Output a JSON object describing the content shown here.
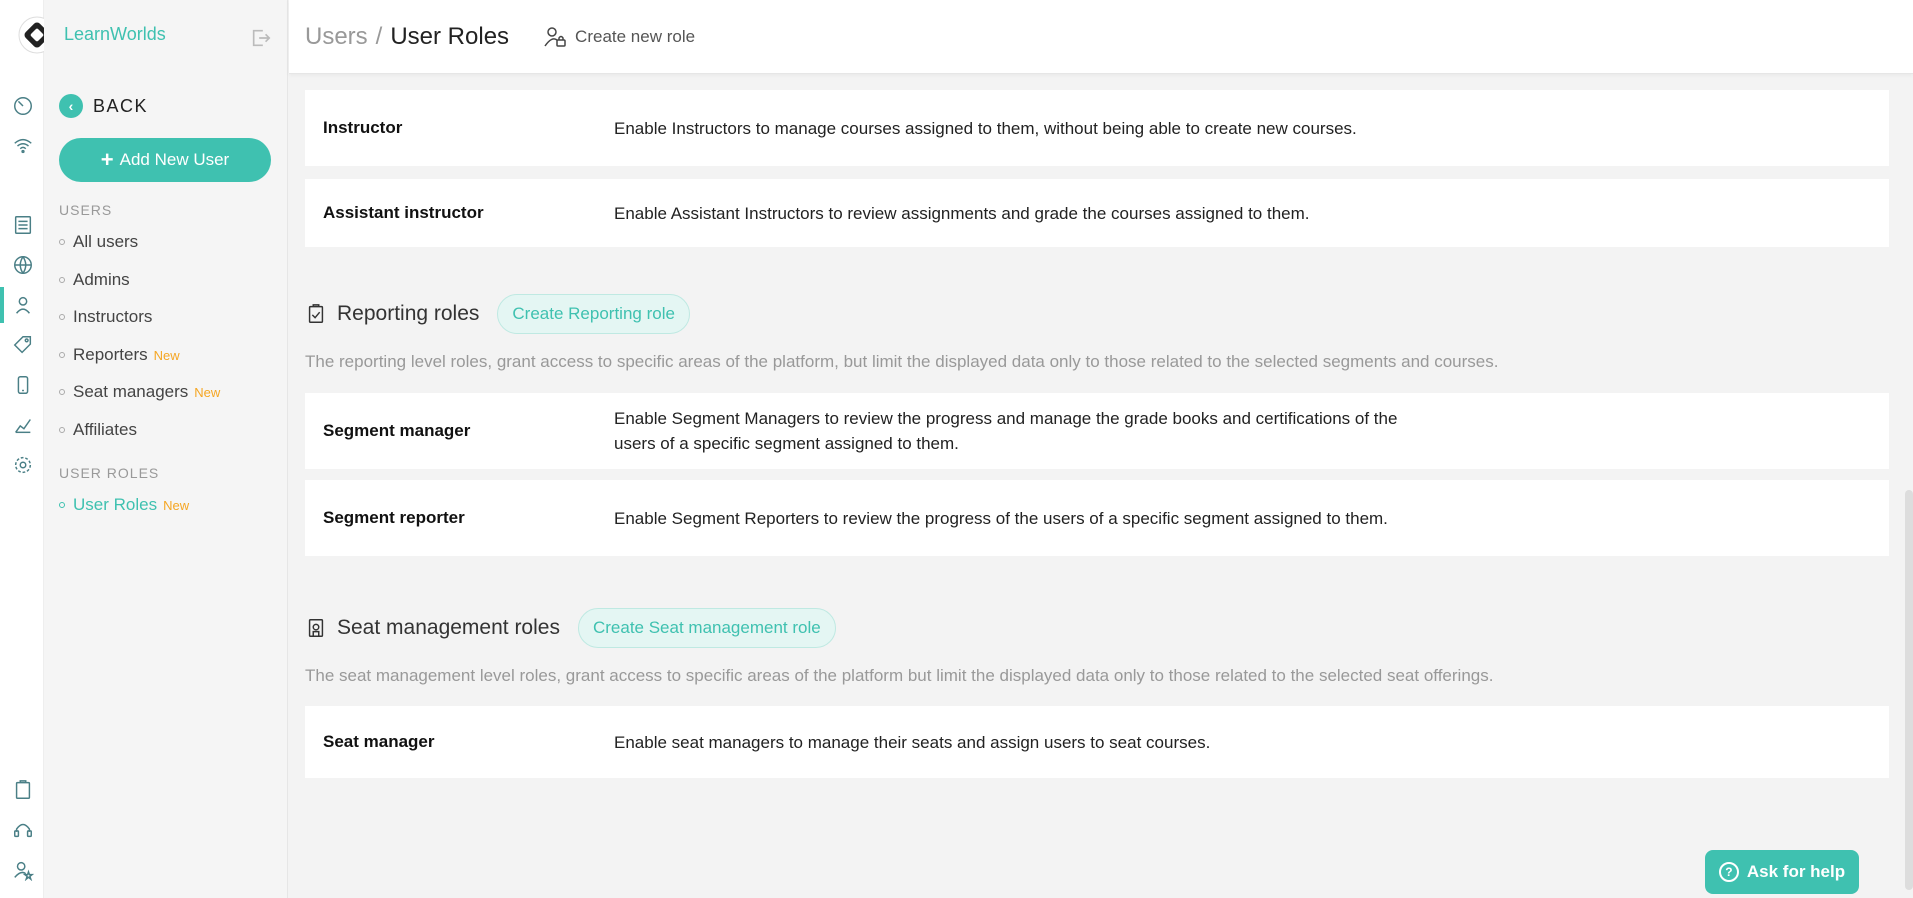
{
  "brand": {
    "name": "LearnWorlds"
  },
  "sidebar": {
    "back_label": "BACK",
    "add_user_label": "Add New User",
    "users_section": "USERS",
    "user_roles_section": "USER ROLES",
    "items": [
      {
        "label": "All users",
        "badge": ""
      },
      {
        "label": "Admins",
        "badge": ""
      },
      {
        "label": "Instructors",
        "badge": ""
      },
      {
        "label": "Reporters",
        "badge": "New"
      },
      {
        "label": "Seat managers",
        "badge": "New"
      },
      {
        "label": "Affiliates",
        "badge": ""
      }
    ],
    "role_items": [
      {
        "label": "User Roles",
        "badge": "New",
        "active": true
      }
    ]
  },
  "header": {
    "crumb_root": "Users",
    "crumb_sep": "/",
    "crumb_current": "User Roles",
    "create_role_label": "Create new role"
  },
  "main": {
    "admin_roles": [
      {
        "name": "Instructor",
        "description": "Enable Instructors to manage courses assigned to them, without being able to create new courses."
      },
      {
        "name": "Assistant instructor",
        "description": "Enable Assistant Instructors to review assignments and grade the courses assigned to them."
      }
    ],
    "reporting": {
      "title": "Reporting roles",
      "button": "Create Reporting role",
      "description": "The reporting level roles, grant access to specific areas of the platform, but limit the displayed data only to those related to the selected segments and courses.",
      "roles": [
        {
          "name": "Segment manager",
          "description": "Enable Segment Managers to review the progress and manage the grade books and certifications of the users of a specific segment assigned to them."
        },
        {
          "name": "Segment reporter",
          "description": "Enable Segment Reporters to review the progress of the users of a specific segment assigned to them."
        }
      ]
    },
    "seat": {
      "title": "Seat management roles",
      "button": "Create Seat management role",
      "description": "The seat management level roles, grant access to specific areas of the platform but limit the displayed data only to those related to the selected seat offerings.",
      "roles": [
        {
          "name": "Seat manager",
          "description": "Enable seat managers to manage their seats and assign users to seat courses."
        }
      ]
    }
  },
  "help": {
    "label": "Ask for help"
  },
  "colors": {
    "accent": "#3fc1b0",
    "badge": "#f5a623"
  }
}
